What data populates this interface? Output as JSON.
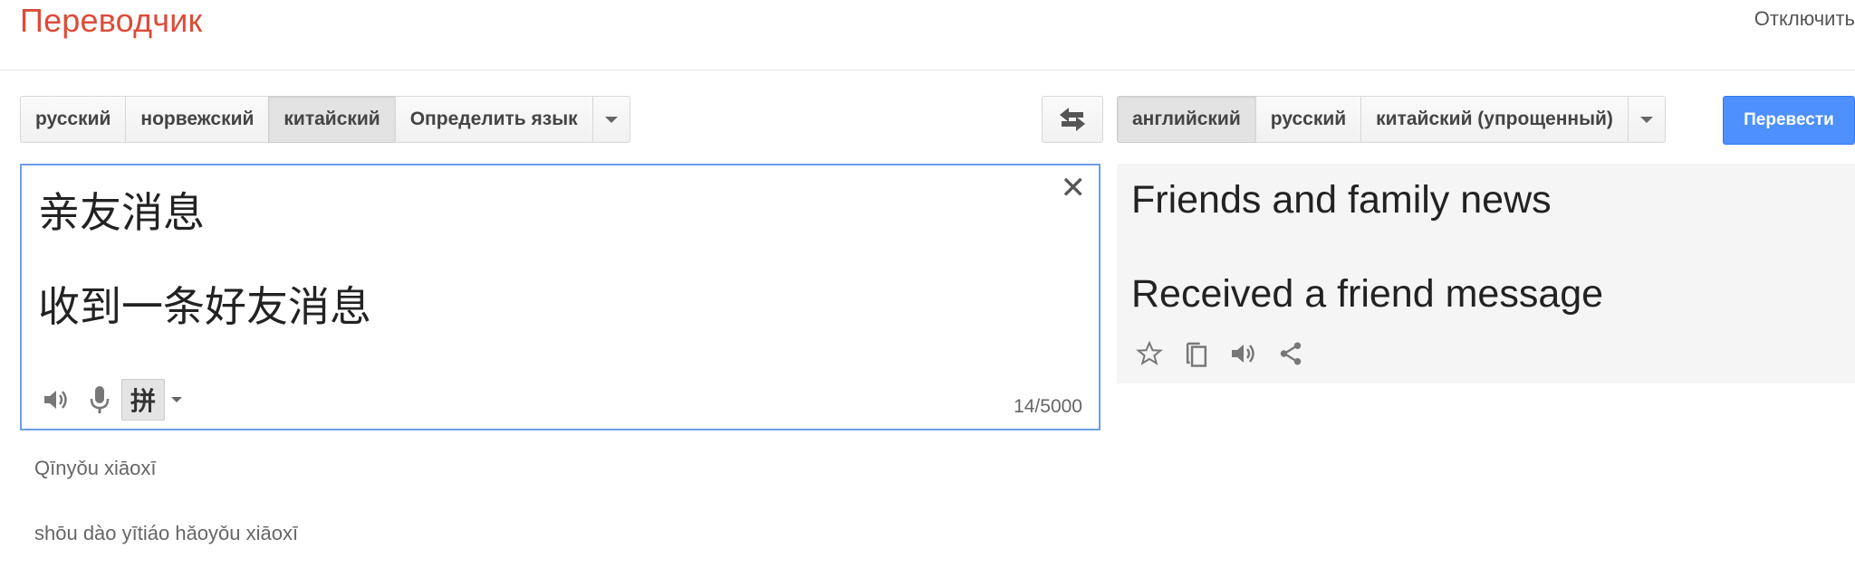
{
  "header": {
    "title": "Переводчик",
    "right_link": "Отключить"
  },
  "source_langs": {
    "items": [
      "русский",
      "норвежский",
      "китайский",
      "Определить язык"
    ],
    "active": "китайский"
  },
  "target_langs": {
    "items": [
      "английский",
      "русский",
      "китайский (упрощенный)"
    ],
    "active": "английский"
  },
  "translate_button": "Перевести",
  "source": {
    "lines": [
      "亲友消息",
      "收到一条好友消息"
    ],
    "ime_label": "拼",
    "char_count": "14/5000"
  },
  "romanization": {
    "lines": [
      "Qīnyǒu xiāoxī",
      "shōu dào yītiáo hǎoyǒu xiāoxī"
    ]
  },
  "result": {
    "lines": [
      "Friends and family news",
      "Received a friend message"
    ]
  },
  "icons": {
    "swap": "swap-languages-icon",
    "clear": "clear-icon",
    "listen": "speaker-icon",
    "mic": "microphone-icon",
    "star": "star-icon",
    "copy": "copy-icon",
    "share": "share-icon"
  },
  "colors": {
    "title": "#dd4b39",
    "translate_button": "#4d90fe",
    "source_border": "#6c9ee8",
    "result_background": "#f5f5f5"
  }
}
